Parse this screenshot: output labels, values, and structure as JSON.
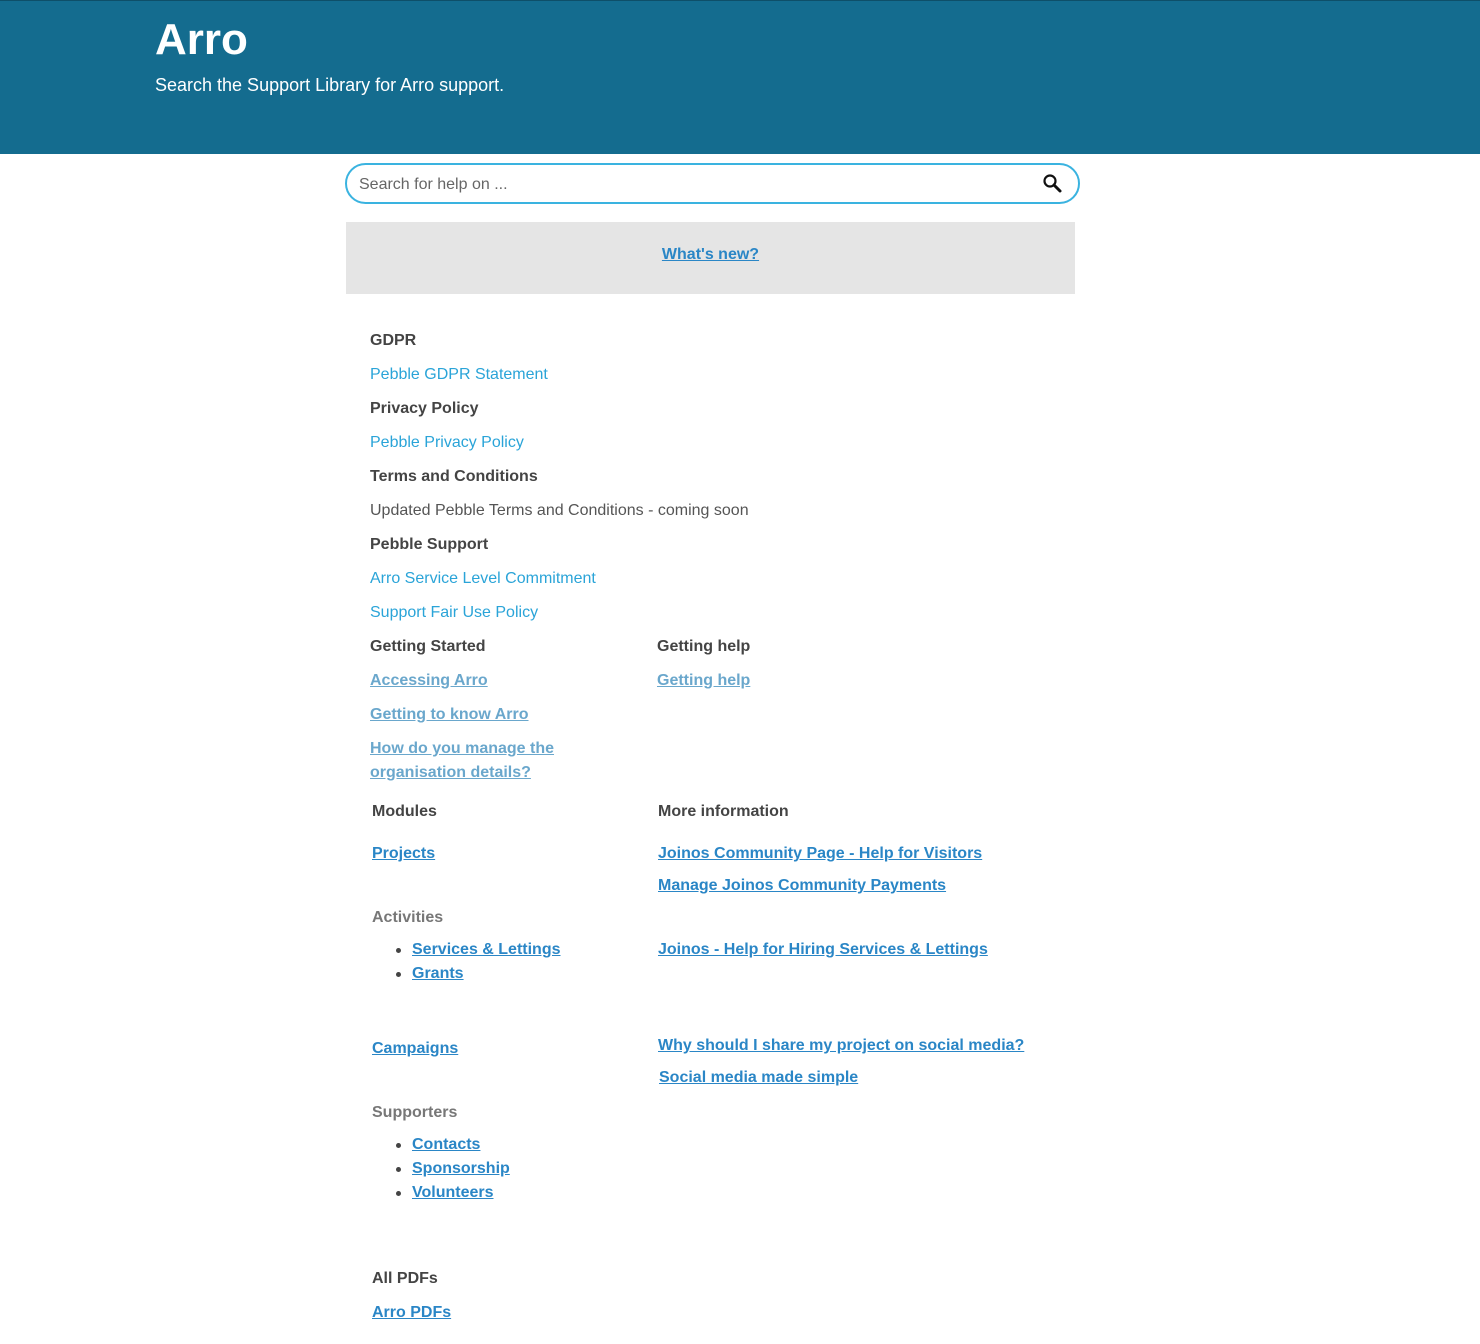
{
  "header": {
    "title": "Arro",
    "subtitle": "Search the Support Library for Arro support."
  },
  "search": {
    "placeholder": "Search for help on ...",
    "icon": "search-icon"
  },
  "whats_new": {
    "label": "What's new?"
  },
  "policies": {
    "gdpr_heading": "GDPR",
    "gdpr_link": "Pebble GDPR Statement",
    "privacy_heading": "Privacy Policy",
    "privacy_link": "Pebble Privacy Policy",
    "terms_heading": "Terms and Conditions",
    "terms_text": "Updated Pebble Terms and Conditions - coming soon",
    "support_heading": "Pebble Support",
    "support_links": [
      "Arro Service Level Commitment",
      "Support Fair Use Policy"
    ]
  },
  "getting_started": {
    "heading": "Getting Started",
    "links": [
      "Accessing Arro",
      "Getting to know Arro",
      "How do you manage the",
      "organisation details?"
    ]
  },
  "getting_help": {
    "heading": "Getting help",
    "link": "Getting help"
  },
  "modules": {
    "heading": "Modules",
    "projects": "Projects",
    "activities_heading": "Activities",
    "activities": [
      "Services & Lettings",
      "Grants"
    ],
    "campaigns": "Campaigns",
    "supporters_heading": "Supporters",
    "supporters": [
      "Contacts",
      "Sponsorship",
      "Volunteers"
    ],
    "pdfs_heading": "All PDFs",
    "pdfs_link": "Arro PDFs"
  },
  "more_info": {
    "heading": "More information",
    "links": [
      "Joinos Community Page - Help for Visitors",
      "Manage Joinos Community Payments",
      "Joinos - Help for Hiring Services & Lettings",
      "Why should I share my project on social media?",
      "Social media made simple"
    ]
  },
  "colors": {
    "header_bg": "#146c8f",
    "search_border": "#3ab3e0",
    "link": "#2a86c6",
    "light_link": "#2aa4d8",
    "box_bg": "#e5e5e5"
  }
}
